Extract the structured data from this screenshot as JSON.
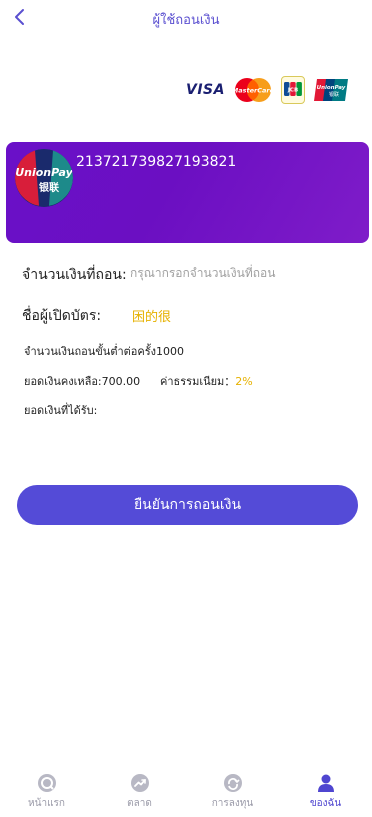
{
  "header": {
    "title": "ผู้ใช้ถอนเงิน",
    "back_icon": "chevron-left-icon"
  },
  "brands": {
    "visa": "VISA",
    "mastercard": "MasterCard",
    "jcb": "JCB",
    "unionpay": "UnionPay",
    "unionpay_cn": "银联"
  },
  "card": {
    "number": "213721739827193821",
    "logo_text": "UnionPay",
    "logo_cn": "银联"
  },
  "form": {
    "amount_label": "จำนวนเงินที่ถอน:",
    "amount_placeholder": "กรุณากรอกจำนวนเงินที่ถอน",
    "holder_label": "ชื่อผู้เปิดบัตร:",
    "holder_value": "困的很"
  },
  "info": {
    "min_text": "จำนวนเงินถอนขั้นต่ำต่อครั้ง1000",
    "balance_text": "ยอดเงินคงเหลือ:700.00",
    "fee_label": "ค่าธรรมเนียม：",
    "fee_value": "2%",
    "received_label": "ยอดเงินที่ได้รับ:"
  },
  "confirm_button": "ยืนยันการถอนเงิน",
  "tabbar": [
    {
      "label": "หน้าแรก",
      "icon": "home-icon",
      "active": false
    },
    {
      "label": "ตลาด",
      "icon": "market-trend-icon",
      "active": false
    },
    {
      "label": "การลงทุน",
      "icon": "investment-icon",
      "active": false
    },
    {
      "label": "ของฉัน",
      "icon": "user-icon",
      "active": true
    }
  ],
  "colors": {
    "accent": "#544bd7",
    "card_purple": "#6a10c8",
    "highlight_yellow": "#e6b100",
    "inactive_tab": "#9a9aa8"
  }
}
